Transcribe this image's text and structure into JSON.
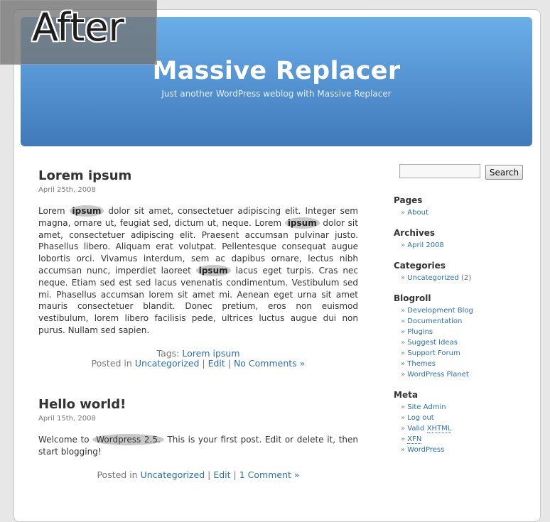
{
  "overlay_label": "After",
  "site": {
    "title": "Massive Replacer",
    "description": "Just another WordPress weblog with Massive Replacer"
  },
  "posts": [
    {
      "title": "Lorem ipsum",
      "date": "April 25th, 2008",
      "tags_label": "Tags:",
      "tag": "Lorem ipsum",
      "posted_in": "Posted in",
      "category": "Uncategorized",
      "edit": "Edit",
      "comments": "No Comments »"
    },
    {
      "title": "Hello world!",
      "date": "April 15th, 2008",
      "body_before": "Welcome to",
      "body_highlight": "Wordpress 2.5.",
      "body_after": "This is your first post. Edit or delete it, then start blogging!",
      "posted_in": "Posted in",
      "category": "Uncategorized",
      "edit": "Edit",
      "comments": "1 Comment »"
    }
  ],
  "post1_body": {
    "t1": "Lorem",
    "h1": "ipsum",
    "t2": "dolor sit amet, consectetuer adipiscing elit. Integer sem magna, ornare ut, feugiat sed, dictum ut, neque. Lorem",
    "h2": "ipsum",
    "t3": "dolor sit amet, consectetuer adipiscing elit. Praesent accumsan pulvinar justo. Phasellus libero. Aliquam erat volutpat. Pellentesque consequat augue lobortis orci. Vivamus interdum, sem ac dapibus ornare, lectus nibh accumsan nunc, imperdiet laoreet",
    "h3": "ipsum",
    "t4": "lacus eget turpis. Cras nec neque. Etiam sed est sed lacus venenatis condimentum. Vestibulum sed mi. Phasellus accumsan lorem sit amet mi. Aenean eget urna sit amet mauris consectetuer blandit. Donec pretium, eros non euismod vestibulum, lorem libero facilisis pede, ultrices luctus augue dui non purus. Nullam sed sapien."
  },
  "search": {
    "button": "Search",
    "value": ""
  },
  "sidebar": {
    "pages": {
      "heading": "Pages",
      "items": [
        "About"
      ]
    },
    "archives": {
      "heading": "Archives",
      "items": [
        "April 2008"
      ]
    },
    "categories": {
      "heading": "Categories",
      "item": "Uncategorized",
      "count": "(2)"
    },
    "blogroll": {
      "heading": "Blogroll",
      "items": [
        "Development Blog",
        "Documentation",
        "Plugins",
        "Suggest Ideas",
        "Support Forum",
        "Themes",
        "WordPress Planet"
      ]
    },
    "meta": {
      "heading": "Meta",
      "items": [
        "Site Admin",
        "Log out"
      ],
      "valid_prefix": "Valid",
      "valid_abbr": "XHTML",
      "xfn": "XFN",
      "wordpress": "WordPress"
    }
  },
  "colors": {
    "header_top": "#6aaee8",
    "header_bottom": "#4079b9",
    "link": "#2a6fb4",
    "highlight": "#c8c8c8"
  }
}
